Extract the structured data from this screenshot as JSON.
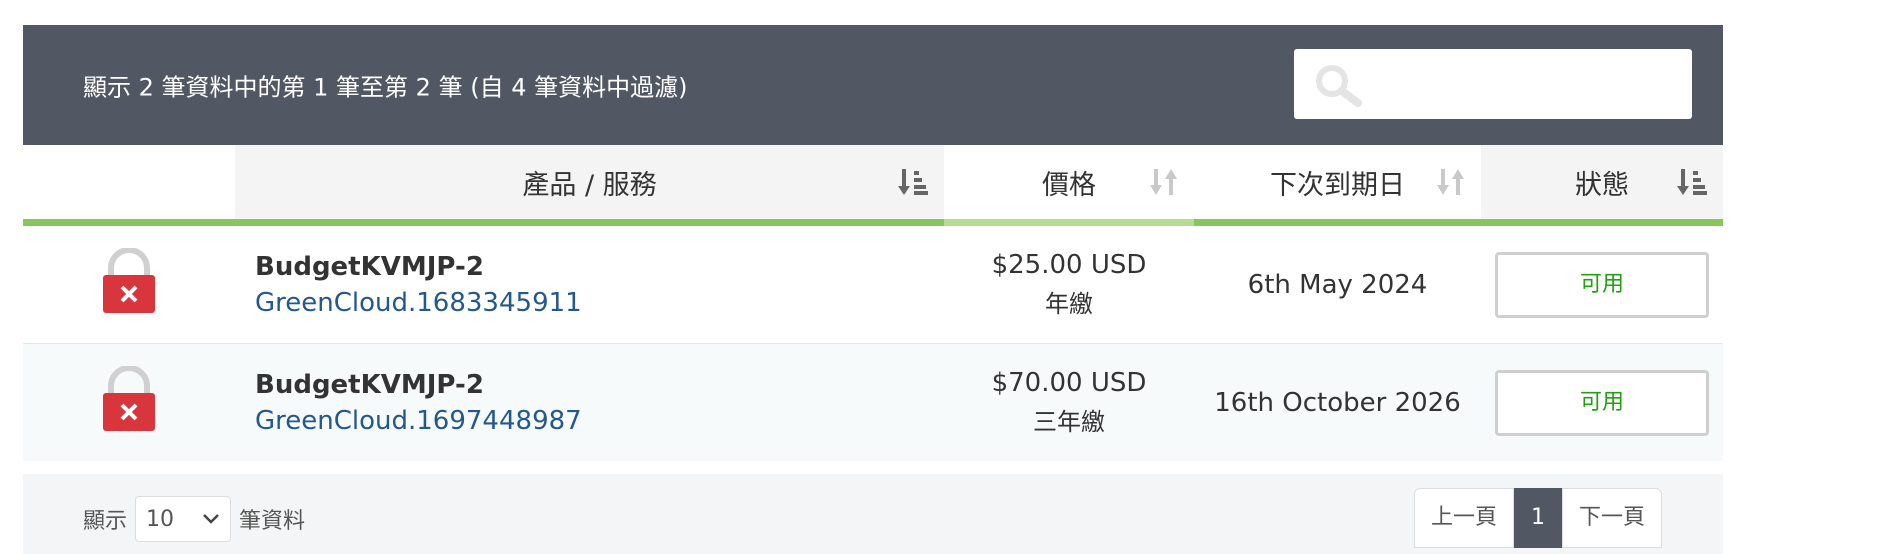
{
  "info_text": "顯示 2 筆資料中的第 1 筆至第 2 筆 (自 4 筆資料中過濾)",
  "search": {
    "placeholder": "",
    "icon": "search-icon"
  },
  "columns": [
    "產品 / 服務",
    "價格",
    "下次到期日",
    "狀態"
  ],
  "rows": [
    {
      "icon": "lock-icon",
      "product": "BudgetKVMJP-2",
      "domain": "GreenCloud.1683345911",
      "price": "$25.00 USD",
      "cycle": "年繳",
      "due": "6th May 2024",
      "status": "可用"
    },
    {
      "icon": "lock-icon",
      "product": "BudgetKVMJP-2",
      "domain": "GreenCloud.1697448987",
      "price": "$70.00 USD",
      "cycle": "三年繳",
      "due": "16th October 2026",
      "status": "可用"
    }
  ],
  "footer": {
    "show_label": "顯示",
    "length_value": "10",
    "records_label": "筆資料"
  },
  "pagination": {
    "prev": "上一頁",
    "current": "1",
    "next": "下一頁"
  },
  "colors": {
    "header_bg": "#525764",
    "accent_green": "#87c65a",
    "status_green": "#22a012",
    "lock_red": "#d9353c",
    "link_blue": "#23588d"
  }
}
